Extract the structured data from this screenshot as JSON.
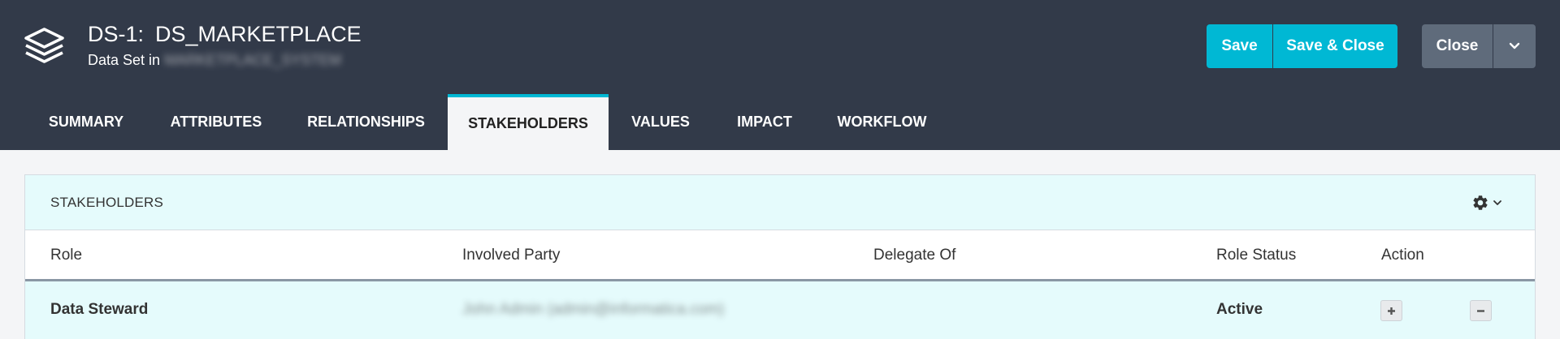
{
  "header": {
    "id": "DS-1:",
    "name": "DS_MARKETPLACE",
    "subtitle_prefix": "Data Set in",
    "subtitle_system": "MARKETPLACE_SYSTEM"
  },
  "buttons": {
    "save": "Save",
    "save_close": "Save & Close",
    "close": "Close"
  },
  "tabs": [
    "SUMMARY",
    "ATTRIBUTES",
    "RELATIONSHIPS",
    "STAKEHOLDERS",
    "VALUES",
    "IMPACT",
    "WORKFLOW"
  ],
  "active_tab": "STAKEHOLDERS",
  "panel": {
    "title": "STAKEHOLDERS",
    "columns": [
      "Role",
      "Involved Party",
      "Delegate Of",
      "Role Status",
      "Action"
    ],
    "rows": [
      {
        "role": "Data Steward",
        "involved_party": "John Admin (admin@informatica.com)",
        "delegate_of": "",
        "role_status": "Active"
      }
    ]
  },
  "colors": {
    "header_bg": "#323a49",
    "accent": "#00b8d4",
    "secondary_button": "#5f6b7b",
    "panel_header_bg": "#e5fbfc"
  }
}
